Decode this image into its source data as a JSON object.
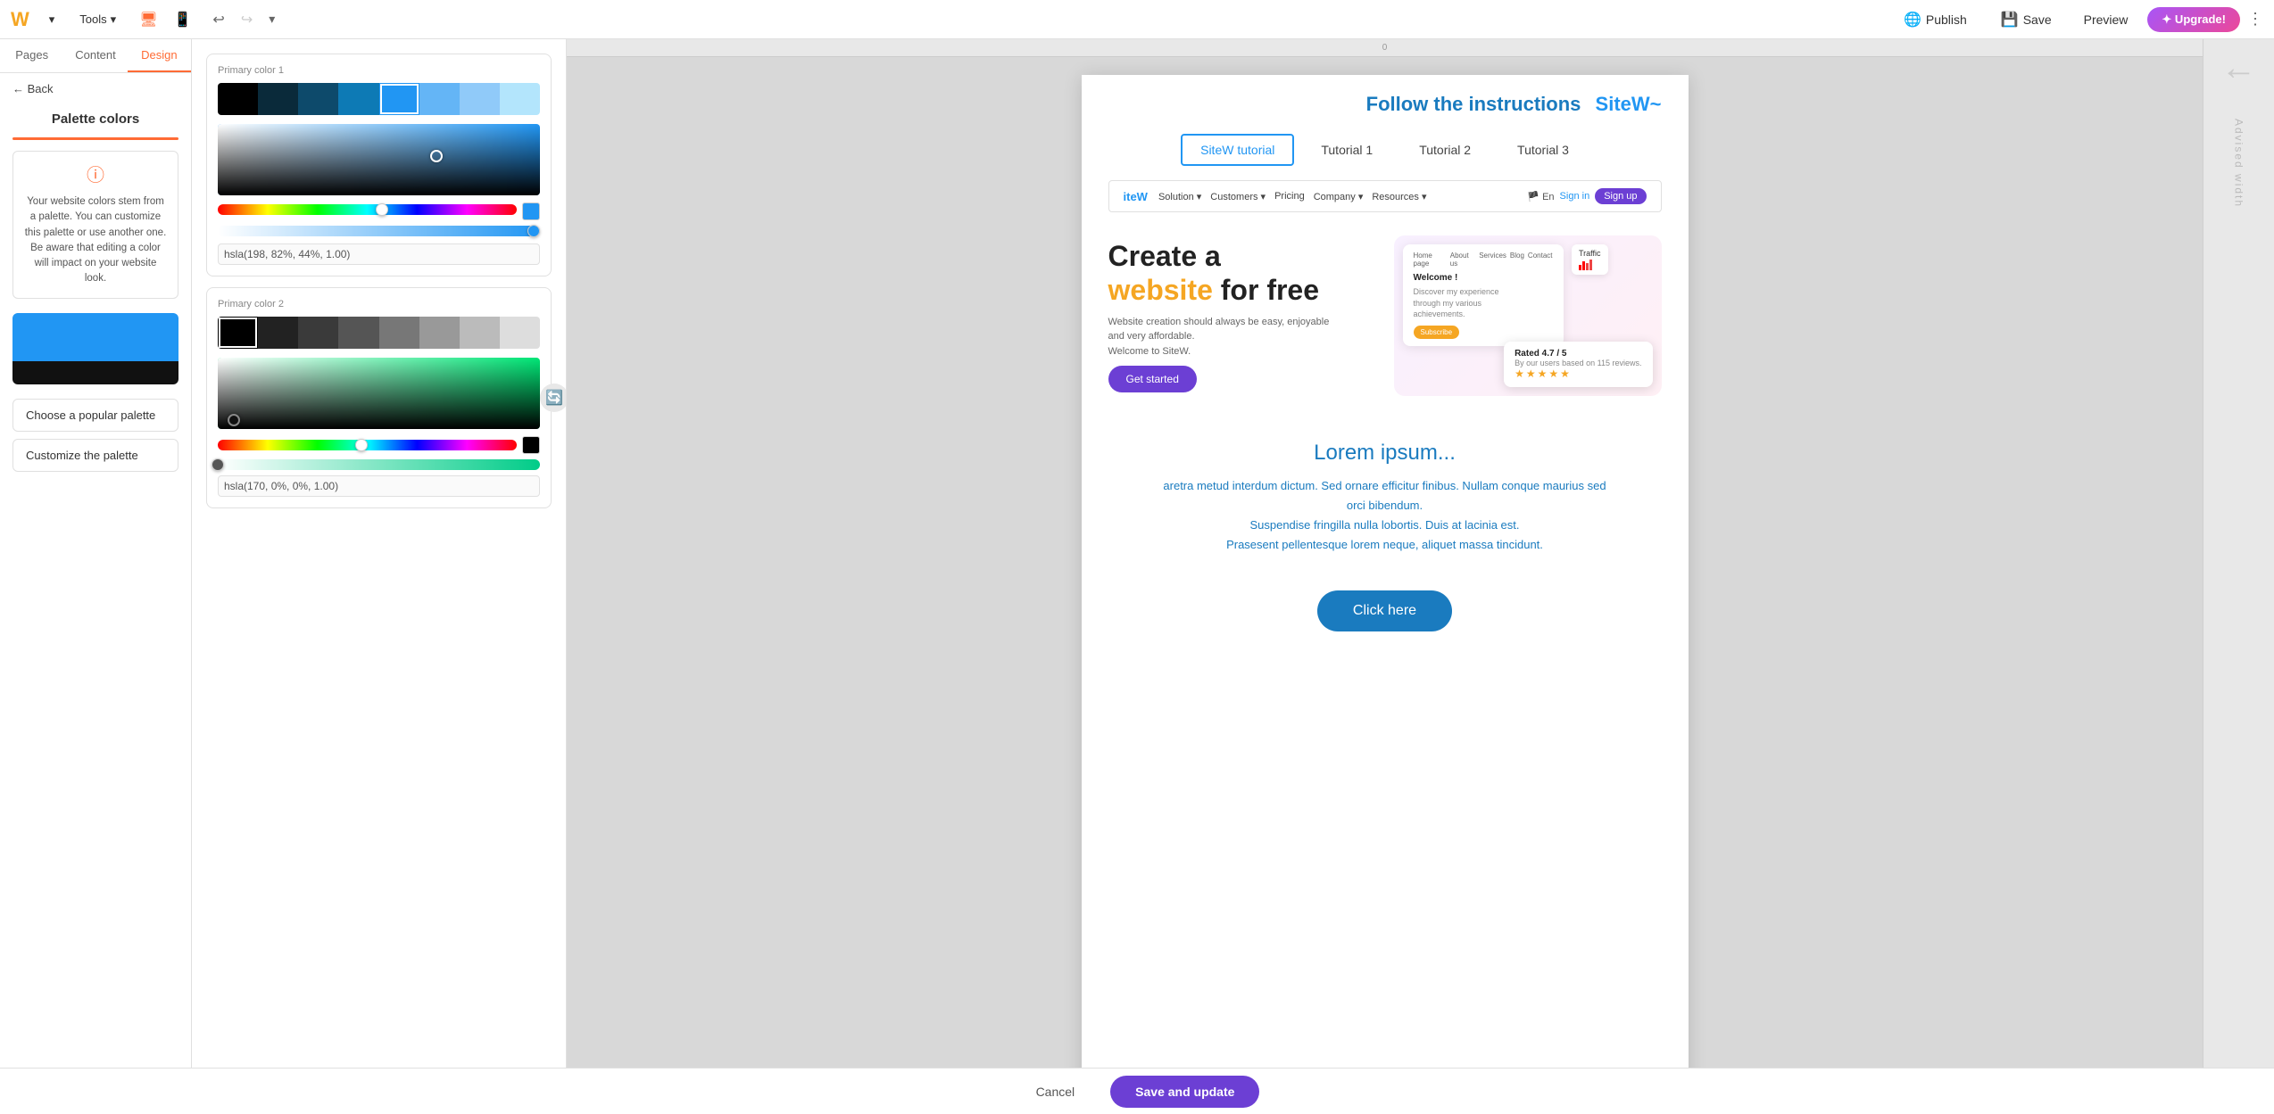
{
  "app": {
    "logo": "W",
    "logo_color": "#6c3fd4"
  },
  "toolbar": {
    "tools_label": "Tools",
    "undo_icon": "↩",
    "redo_icon": "↪",
    "desktop_icon": "🖥",
    "mobile_icon": "📱",
    "publish_label": "Publish",
    "save_label": "Save",
    "preview_label": "Preview",
    "upgrade_label": "✦ Upgrade!",
    "more_icon": "⋮"
  },
  "sidebar": {
    "tab_pages": "Pages",
    "tab_content": "Content",
    "tab_design": "Design",
    "back_label": "← Back",
    "palette_title": "Palette colors",
    "info_icon": "ⓘ",
    "info_text": "Your website colors stem from a palette. You can customize this palette or use another one. Be aware that editing a color will impact on your website look.",
    "choose_palette_label": "Choose a popular palette",
    "customize_palette_label": "Customize the palette"
  },
  "color_picker": {
    "primary1_label": "Primary color 1",
    "primary2_label": "Primary color 2",
    "hsl1_value": "hsla(198, 82%, 44%, 1.00)",
    "hsl2_value": "hsla(170, 0%, 0%, 1.00)",
    "swatches1": [
      "#000000",
      "#0a2a3a",
      "#0d4a6b",
      "#0d7ab5",
      "#2196f3",
      "#64b5f6",
      "#90caf9",
      "#b3e5fc"
    ],
    "swatches2": [
      "#000000",
      "#2a2a2a",
      "#444444",
      "#666666",
      "#888888",
      "#aaaaaa",
      "#cccccc",
      "#eeeeee"
    ],
    "picker1_handle_x": "68%",
    "picker1_handle_y": "45%",
    "picker2_handle_x": "5%",
    "picker2_handle_y": "88%",
    "hue1_pos": "55%",
    "hue2_pos": "48%",
    "alpha1_pos": "100%",
    "alpha2_pos": "0%"
  },
  "page": {
    "header_title": "Follow the instructions",
    "tabs": [
      "SiteW tutorial",
      "Tutorial 1",
      "Tutorial 2",
      "Tutorial 3"
    ],
    "active_tab": "SiteW tutorial",
    "mini_nav": {
      "logo": "iteW",
      "items": [
        "Solution ▾",
        "Customers ▾",
        "Pricing",
        "Company ▾",
        "Resources ▾"
      ],
      "lang": "🏴 En",
      "signin": "Sign in",
      "signup": "Sign up"
    },
    "hero": {
      "title_line1": "Create a",
      "title_line2": "website",
      "title_line3": " for free",
      "subtitle": "Website creation should always be easy, enjoyable\nand very affordable.\nWelcome to SiteW.",
      "btn_label": "Get started",
      "card_title": "Welcome !",
      "card_text": "Discover my experience\nthrough my various\nachievements.",
      "card_btn": "Subscribe",
      "traffic_label": "Traffic",
      "rating": "Rated 4.7 / 5",
      "rating_sub": "By our users based on 115 reviews.",
      "stars": "★★★★★"
    },
    "lorem": {
      "title": "Lorem ipsum...",
      "text": "aretra metud interdum dictum. Sed ornare efficitur finibus. Nullam conque maurius sed orci bibendum.\nSuspendise fringilla nulla lobortis. Duis at lacinia est.\nPrasesent pellentesque lorem neque, aliquet massa tincidunt."
    },
    "click_here_label": "Click here"
  },
  "bottom_bar": {
    "cancel_label": "Cancel",
    "save_update_label": "Save and update"
  },
  "right_panel": {
    "arrow": "←",
    "advised_label": "Advised width"
  }
}
